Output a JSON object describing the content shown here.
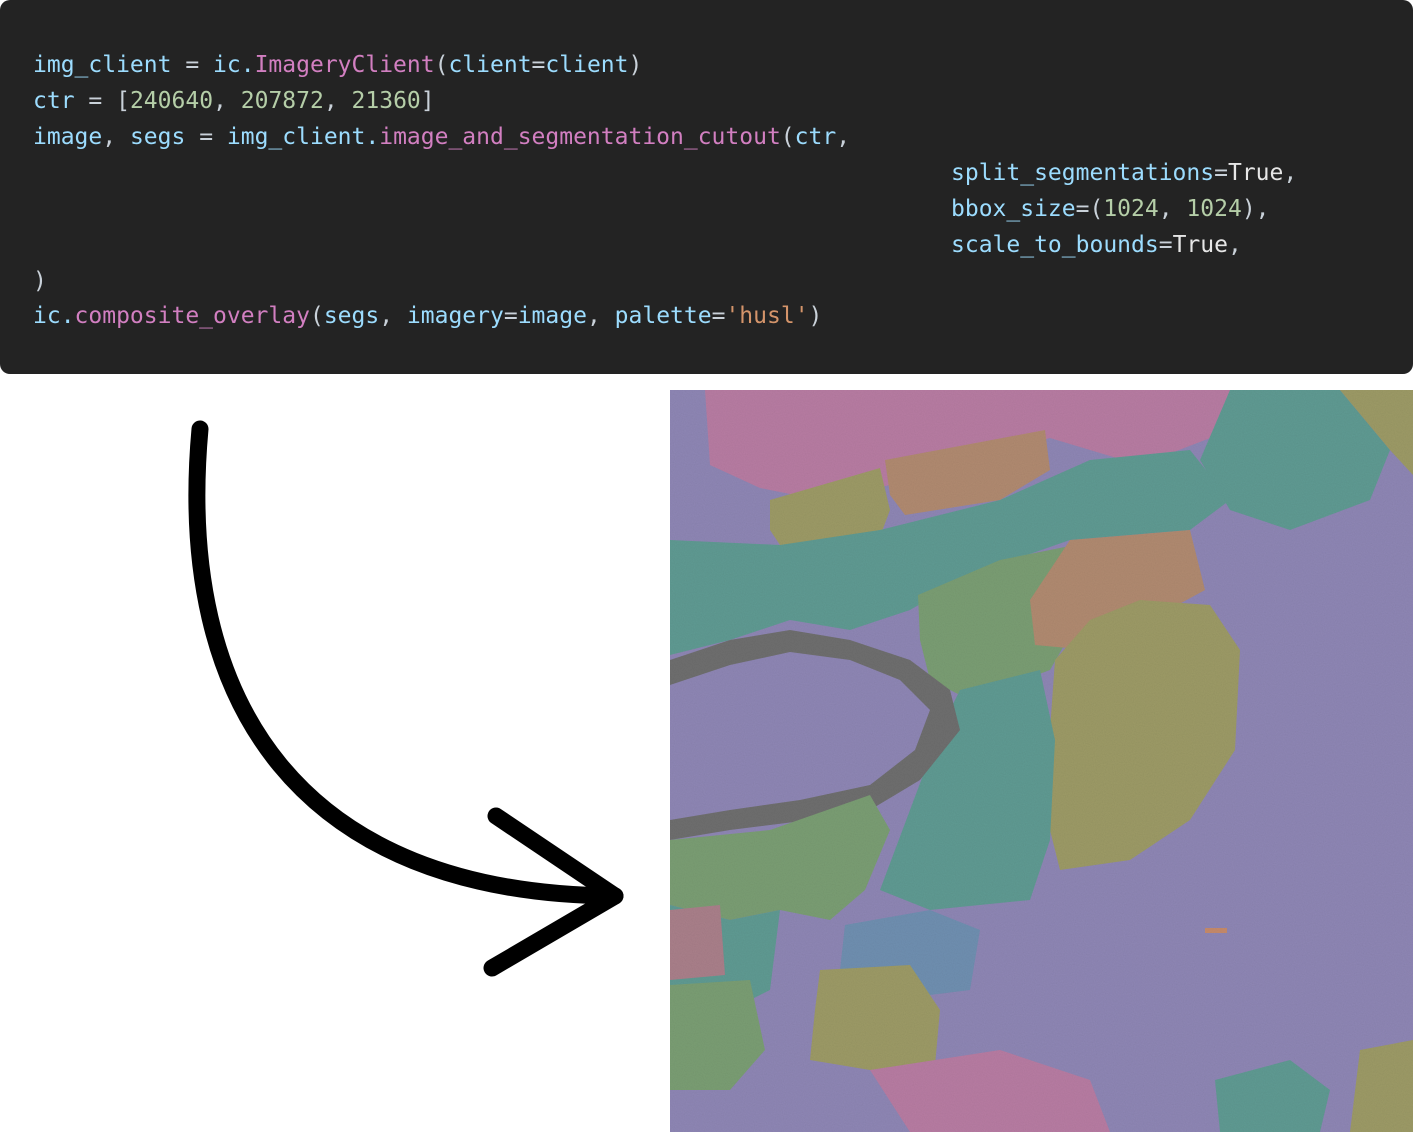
{
  "code": {
    "line1": {
      "var": "img_client",
      "eq": " = ",
      "mod": "ic.",
      "cls": "ImageryClient",
      "open": "(",
      "arg": "client",
      "eq2": "=",
      "val": "client",
      "close": ")"
    },
    "line2": {
      "var": "ctr",
      "eq": " = ",
      "open": "[",
      "n1": "240640",
      "sep1": ", ",
      "n2": "207872",
      "sep2": ", ",
      "n3": "21360",
      "close": "]"
    },
    "line3": {
      "var1": "image",
      "sep": ", ",
      "var2": "segs",
      "eq": " = ",
      "obj": "img_client.",
      "method": "image_and_segmentation_cutout",
      "open": "(",
      "arg": "ctr",
      "comma": ","
    },
    "line4": {
      "arg": "split_segmentations",
      "eq": "=",
      "val": "True",
      "comma": ","
    },
    "line5": {
      "arg": "bbox_size",
      "eq": "=(",
      "n1": "1024",
      "sep": ", ",
      "n2": "1024",
      "close": "),"
    },
    "line6": {
      "arg": "scale_to_bounds",
      "eq": "=",
      "val": "True",
      "comma": ","
    },
    "line7": {
      "close": ")"
    },
    "line8": {
      "mod": "ic.",
      "method": "composite_overlay",
      "open": "(",
      "arg1": "segs",
      "sep": ", ",
      "kw1": "imagery",
      "eq1": "=",
      "val1": "image",
      "sep2": ", ",
      "kw2": "palette",
      "eq2": "=",
      "str": "'husl'",
      "close": ")"
    }
  },
  "figure": {
    "arrow_icon": "curved-arrow-icon",
    "overlay_palette": {
      "lavender": "#8e86b4",
      "pink": "#b77ca2",
      "teal": "#5f9a92",
      "green": "#7a9d73",
      "olive": "#9c9a66",
      "orange": "#b08a70",
      "blue": "#6f8fb0",
      "gray": "#6e6e6e",
      "rose": "#a97f8a"
    }
  }
}
